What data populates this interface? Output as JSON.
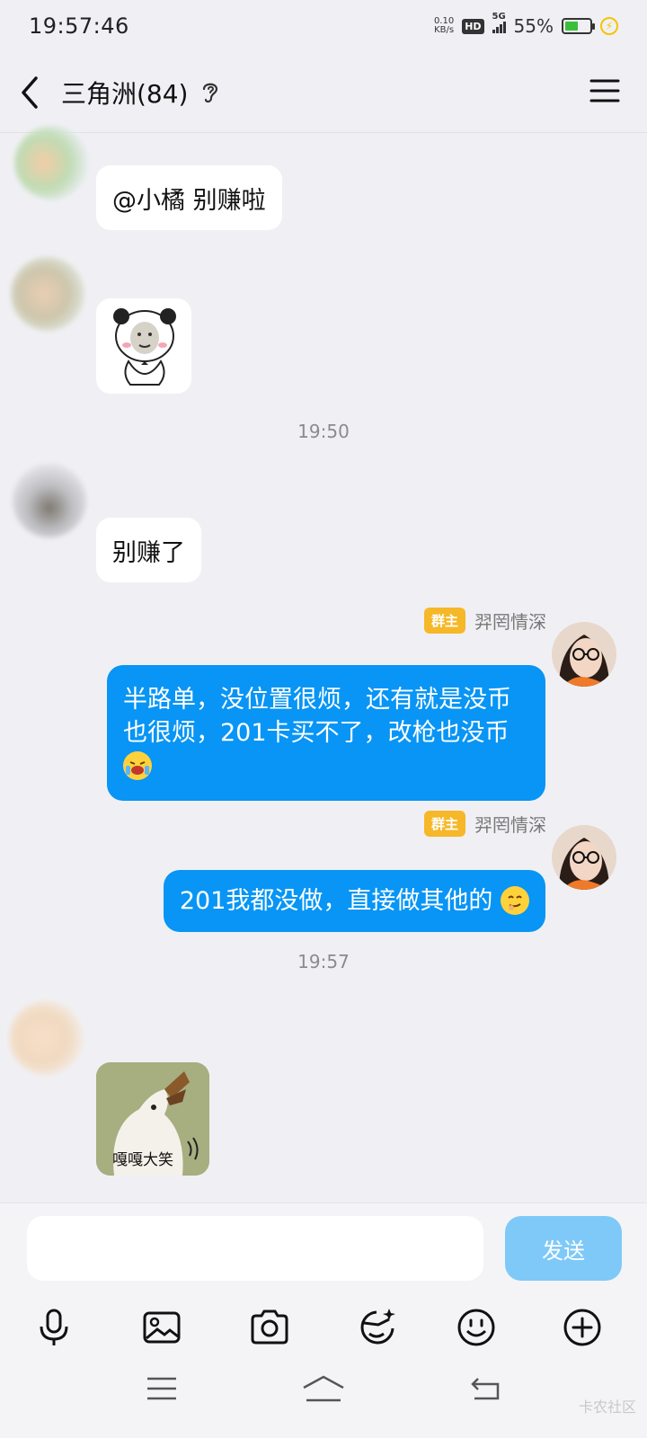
{
  "status_bar": {
    "time": "19:57:46",
    "net_speed_value": "0.10",
    "net_speed_unit": "KB/s",
    "hd": "HD",
    "network": "5G",
    "battery_percent": "55%",
    "battery_level": 0.55,
    "battery_color": "#3bbf3b"
  },
  "header": {
    "title": "三角洲(84)",
    "back_icon": "chevron-left-icon",
    "ear_icon": "ear-icon",
    "menu_icon": "hamburger-menu-icon"
  },
  "messages": [
    {
      "kind": "text",
      "side": "left",
      "text": "@小橘 别赚啦"
    },
    {
      "kind": "sticker",
      "side": "left",
      "sticker": "panda-meme-sticker"
    },
    {
      "kind": "time",
      "text": "19:50"
    },
    {
      "kind": "text",
      "side": "left",
      "text": "别赚了"
    },
    {
      "kind": "text",
      "side": "right",
      "role": "群主",
      "sender": "羿罔情深",
      "text": "半路单，没位置很烦，还有就是没币也很烦，201卡买不了，改枪也没币"
    },
    {
      "kind": "text",
      "side": "right",
      "role": "群主",
      "sender": "羿罔情深",
      "text": "201我都没做，直接做其他的"
    },
    {
      "kind": "time",
      "text": "19:57"
    },
    {
      "kind": "sticker",
      "side": "left",
      "sticker": "duck-laugh-sticker",
      "caption": "嘎嘎大笑"
    }
  ],
  "composer": {
    "input_value": "",
    "send_label": "发送",
    "accent": "#0895f5",
    "send_disabled_color": "#7fc9f8"
  },
  "toolbar": [
    "microphone-icon",
    "image-icon",
    "camera-icon",
    "face-effect-icon",
    "emoji-icon",
    "plus-circle-icon"
  ],
  "navbar": [
    "menu-nav-icon",
    "home-nav-icon",
    "back-nav-icon"
  ],
  "watermark": "卡农社区"
}
